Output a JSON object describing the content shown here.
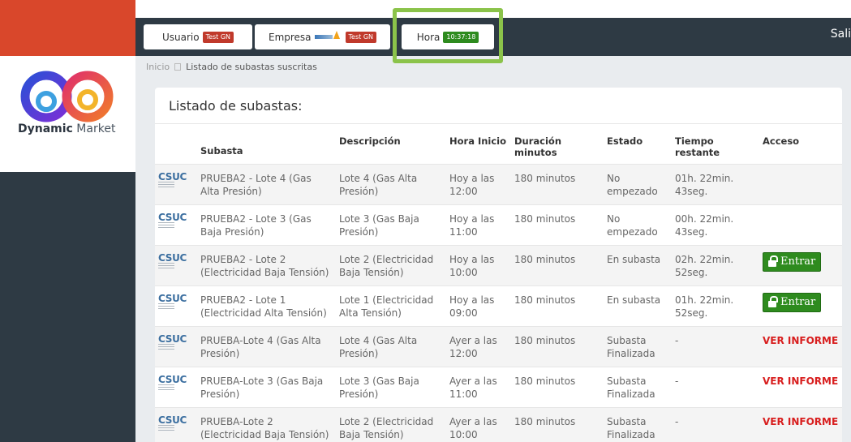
{
  "brand": {
    "name_bold": "Dynamic",
    "name_light": " Market",
    "accent": "#d9472b",
    "dark": "#2e3a44"
  },
  "header": {
    "user_label": "Usuario",
    "user_badge": "Test GN",
    "company_label": "Empresa",
    "company_badge": "Test GN",
    "time_label": "Hora",
    "time_value": "10:37:18",
    "logout_label": "Sali"
  },
  "breadcrumb": {
    "home": "Inicio",
    "current": "Listado de subastas suscritas"
  },
  "card": {
    "title": "Listado de subastas:"
  },
  "table": {
    "columns": [
      "Subasta",
      "Descripción",
      "Hora Inicio",
      "Duración minutos",
      "Estado",
      "Tiempo restante",
      "Acceso"
    ],
    "logo_text": "CSUC",
    "entrar_label": "Entrar",
    "rows": [
      {
        "subasta": "PRUEBA2 - Lote 4 (Gas Alta Presión)",
        "descripcion": "Lote 4 (Gas Alta Presión)",
        "hora": "Hoy a las 12:00",
        "duracion": "180 minutos",
        "estado": "No empezado",
        "tiempo": "01h. 22min. 43seg.",
        "acceso": ""
      },
      {
        "subasta": "PRUEBA2 - Lote 3 (Gas Baja Presión)",
        "descripcion": "Lote 3 (Gas Baja Presión)",
        "hora": "Hoy a las 11:00",
        "duracion": "180 minutos",
        "estado": "No empezado",
        "tiempo": "00h. 22min. 43seg.",
        "acceso": ""
      },
      {
        "subasta": "PRUEBA2 - Lote 2 (Electricidad Baja Tensión)",
        "descripcion": "Lote 2 (Electricidad Baja Tensión)",
        "hora": "Hoy a las 10:00",
        "duracion": "180 minutos",
        "estado": "En subasta",
        "tiempo": "02h. 22min. 52seg.",
        "acceso": "entrar"
      },
      {
        "subasta": "PRUEBA2 - Lote 1 (Electricidad Alta Tensión)",
        "descripcion": "Lote 1 (Electricidad Alta Tensión)",
        "hora": "Hoy a las 09:00",
        "duracion": "180 minutos",
        "estado": "En subasta",
        "tiempo": "01h. 22min. 52seg.",
        "acceso": "entrar"
      },
      {
        "subasta": "PRUEBA-Lote 4 (Gas Alta Presión)",
        "descripcion": "Lote 4 (Gas Alta Presión)",
        "hora": "Ayer a las 12:00",
        "duracion": "180 minutos",
        "estado": "Subasta Finalizada",
        "tiempo": "-",
        "acceso": "VER INFORME"
      },
      {
        "subasta": "PRUEBA-Lote 3 (Gas Baja Presión)",
        "descripcion": "Lote 3 (Gas Baja Presión)",
        "hora": "Ayer a las 11:00",
        "duracion": "180 minutos",
        "estado": "Subasta Finalizada",
        "tiempo": "-",
        "acceso": "VER INFORME"
      },
      {
        "subasta": "PRUEBA-Lote 2 (Electricidad Baja Tensión)",
        "descripcion": "Lote 2 (Electricidad Baja Tensión)",
        "hora": "Ayer a las 10:00",
        "duracion": "180 minutos",
        "estado": "Subasta Finalizada",
        "tiempo": "-",
        "acceso": "VER INFORME"
      }
    ]
  }
}
